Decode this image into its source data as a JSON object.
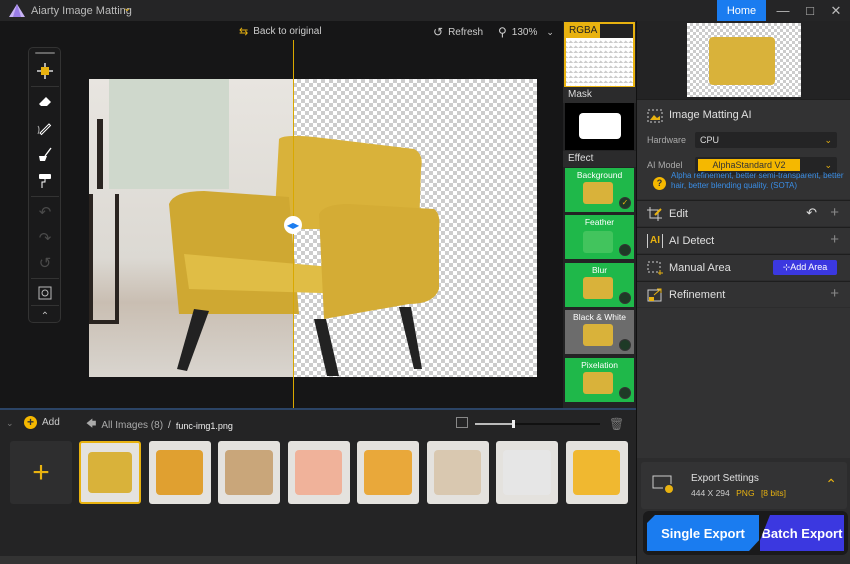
{
  "app": {
    "title": "Aiarty Image Matting",
    "home_label": "Home"
  },
  "canvas_toolbar": {
    "back_label": "Back to original",
    "refresh_label": "Refresh",
    "zoom_level": "130%"
  },
  "tools": [
    "move-select",
    "eraser",
    "brush-pen",
    "fill-brush",
    "paint-roller",
    "undo",
    "redo",
    "reset",
    "fit-view",
    "collapse"
  ],
  "preview_column": {
    "rgba_label": "RGBA",
    "mask_label": "Mask",
    "effect_label": "Effect",
    "effects": [
      {
        "name": "Background",
        "selected": true
      },
      {
        "name": "Feather",
        "selected": false
      },
      {
        "name": "Blur",
        "selected": false
      },
      {
        "name": "Black & White",
        "selected": false
      },
      {
        "name": "Pixelation",
        "selected": false
      }
    ]
  },
  "right_panel": {
    "matting": {
      "title": "Image Matting AI",
      "hardware_label": "Hardware",
      "hardware_value": "CPU",
      "model_label": "AI Model",
      "model_value": "AlphaStandard  V2",
      "hint": "Alpha refinement, better semi-transparent, better hair, better blending quality. (SOTA)"
    },
    "sections": [
      {
        "title": "Edit"
      },
      {
        "title": "AI Detect"
      },
      {
        "title": "Manual Area",
        "action": "Add Area"
      },
      {
        "title": "Refinement"
      }
    ],
    "export": {
      "title": "Export Settings",
      "size": "444 X 294",
      "format": "PNG",
      "bits": "[8 bits]",
      "single_label": "Single Export",
      "batch_label": "Batch Export"
    }
  },
  "bottom": {
    "add_label": "Add",
    "breadcrumb_root": "All Images (8)",
    "breadcrumb_sep": "/",
    "breadcrumb_file": "func-img1.png",
    "thumbnail_zoom": 0.3,
    "thumbnails": [
      {
        "name": "yellow-armchair",
        "selected": true,
        "color": "#d9b23a"
      },
      {
        "name": "perfume-bottle",
        "selected": false,
        "color": "#e0a030"
      },
      {
        "name": "trench-coat",
        "selected": false,
        "color": "#c9a67a"
      },
      {
        "name": "peach-rose",
        "selected": false,
        "color": "#f0b29a"
      },
      {
        "name": "burgers",
        "selected": false,
        "color": "#e9a83a"
      },
      {
        "name": "candy-jar",
        "selected": false,
        "color": "#d9c8b0"
      },
      {
        "name": "white-sofa",
        "selected": false,
        "color": "#e6e6e6"
      },
      {
        "name": "flower-portrait",
        "selected": false,
        "color": "#f0b830"
      }
    ]
  },
  "colors": {
    "accent": "#e8b210",
    "blue": "#1a7cf0",
    "purple": "#3b38e0",
    "effect_green": "#1fb84a"
  }
}
